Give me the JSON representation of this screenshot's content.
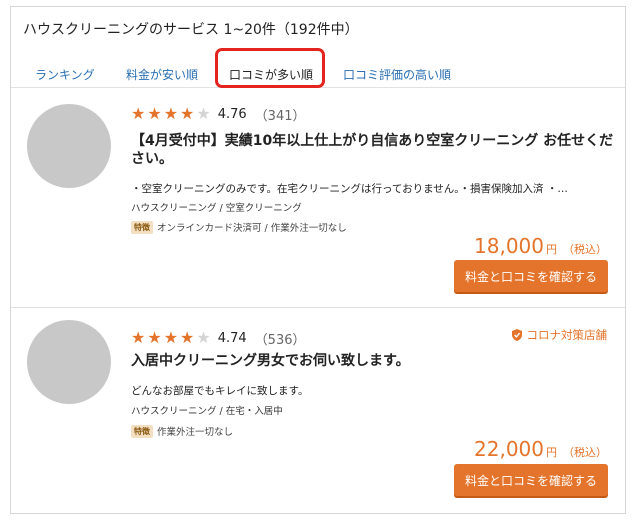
{
  "heading": "ハウスクリーニングのサービス 1~20件（192件中）",
  "tabs": [
    {
      "label": "ランキング"
    },
    {
      "label": "料金が安い順"
    },
    {
      "label": "口コミが多い順"
    },
    {
      "label": "口コミ評価の高い順"
    }
  ],
  "active_tab": "口コミが多い順",
  "colors": {
    "accent": "#e4742b",
    "link": "#2a6fb3",
    "highlight": "#e4251f"
  },
  "listings": [
    {
      "stars": 4,
      "rating": "4.76",
      "reviews": "（341）",
      "title": "【4月受付中】実績10年以上仕上がり自信あり空室クリーニング お任せください。",
      "description": "・空室クリーニングのみです。在宅クリーニングは行っておりません。・損害保険加入済 ・…",
      "category": "ハウスクリーニング / 空室クリーニング",
      "feature_tag": "特徴",
      "features": "オンラインカード決済可 / 作業外注一切なし",
      "price": "18,000",
      "price_unit": "円",
      "price_tax": "（税込）",
      "cta": "料金と口コミを確認する"
    },
    {
      "stars": 4,
      "rating": "4.74",
      "reviews": "（536）",
      "badge": "コロナ対策店舗",
      "badge_icon": "shield-check-icon",
      "title": "入居中クリーニング男女でお伺い致します。",
      "description": "どんなお部屋でもキレイに致します。",
      "category": "ハウスクリーニング / 在宅・入居中",
      "feature_tag": "特徴",
      "features": "作業外注一切なし",
      "price": "22,000",
      "price_unit": "円",
      "price_tax": "（税込）",
      "cta": "料金と口コミを確認する"
    }
  ]
}
